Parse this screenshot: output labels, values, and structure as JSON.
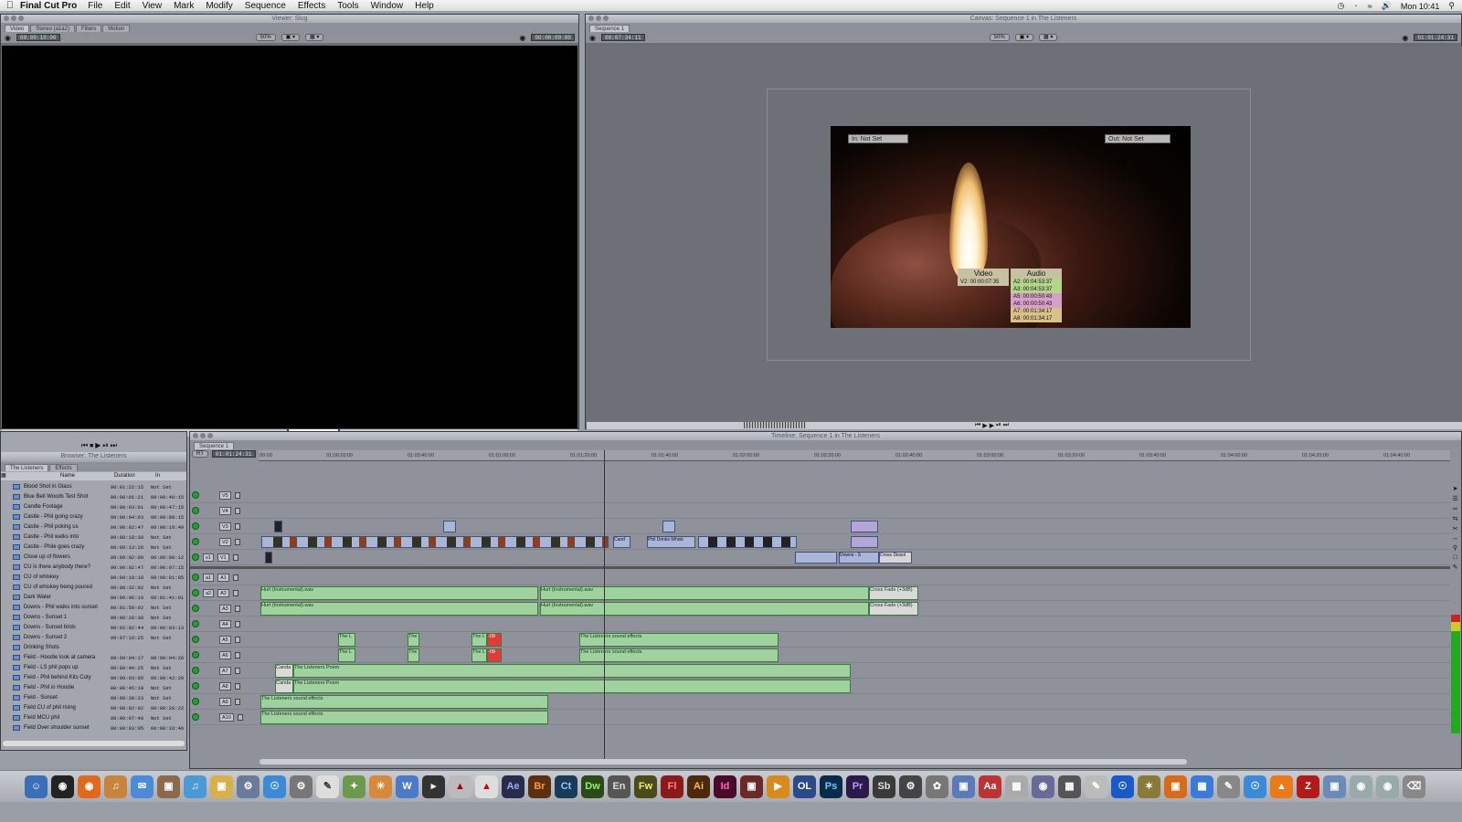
{
  "menubar": {
    "app_name": "Final Cut Pro",
    "menus": [
      "File",
      "Edit",
      "View",
      "Mark",
      "Modify",
      "Sequence",
      "Effects",
      "Tools",
      "Window",
      "Help"
    ],
    "clock": "Mon 10:41"
  },
  "viewer": {
    "title": "Viewer: Slug",
    "tabs": [
      "Video",
      "Stereo (a1a2)",
      "Filters",
      "Motion"
    ],
    "timecode_duration": "00:00:10:00",
    "zoom": "50%",
    "timecode_current": "00:00:00:00"
  },
  "canvas": {
    "title": "Canvas: Sequence 1 in The Listeners",
    "tab": "Sequence 1",
    "timecode_duration": "00:07:34:11",
    "zoom": "50%",
    "timecode_current": "01:01:24:31",
    "in_label": "In: Not Set",
    "out_label": "Out: Not Set",
    "video_box": {
      "header": "Video",
      "line": "V2: 00:00:07:35"
    },
    "audio_box": {
      "header": "Audio",
      "lines": [
        "A2: 00:04:53:37",
        "A3: 00:04:53:37",
        "A5: 00:00:50:43",
        "A6: 00:00:50:43",
        "A7: 00:01:34:17",
        "A8: 00:01:34:17"
      ]
    }
  },
  "browser": {
    "title": "Browser: The Listeners",
    "tabs": [
      "The Listeners",
      "Effects"
    ],
    "columns": {
      "name": "Name",
      "duration": "Duration",
      "in": "In"
    },
    "rows": [
      {
        "name": "Blood Shot in Glass",
        "duration": "00:01:22:15",
        "in": "Not Set"
      },
      {
        "name": "Blue Bell Woods Test Shot",
        "duration": "00:00:01:21",
        "in": "00:00:40:15"
      },
      {
        "name": "Candle Footage",
        "duration": "00:00:03:01",
        "in": "00:00:47:15"
      },
      {
        "name": "Castle - Phil going crazy",
        "duration": "00:00:04:03",
        "in": "00:00:09:15"
      },
      {
        "name": "Castle - Phil poking us",
        "duration": "00:00:02:47",
        "in": "00:00:19:49"
      },
      {
        "name": "Castle - Phil walks into",
        "duration": "00:00:18:30",
        "in": "Not Set"
      },
      {
        "name": "Castle - Phile goes crazy",
        "duration": "00:00:13:26",
        "in": "Not Set"
      },
      {
        "name": "Close up of flowers",
        "duration": "00:00:02:00",
        "in": "00:00:00:12"
      },
      {
        "name": "CU is there anybody there?",
        "duration": "00:00:02:47",
        "in": "00:00:07:15"
      },
      {
        "name": "CU of whiskey",
        "duration": "00:00:10:18",
        "in": "00:00:01:05"
      },
      {
        "name": "CU of whiskey being poured",
        "duration": "00:00:32:02",
        "in": "Not Set"
      },
      {
        "name": "Dark Water",
        "duration": "00:00:06:19",
        "in": "00:01:41:01"
      },
      {
        "name": "Downs - Phil walks into sunset",
        "duration": "00:01:50:02",
        "in": "Not Set"
      },
      {
        "name": "Downs - Sunset 1",
        "duration": "00:00:20:38",
        "in": "Not Set"
      },
      {
        "name": "Downs - Sunset birds",
        "duration": "00:02:02:44",
        "in": "00:00:03:13"
      },
      {
        "name": "Downs - Sunset 2",
        "duration": "00:07:16:25",
        "in": "Not Set"
      },
      {
        "name": "Drinking Shots",
        "duration": "",
        "in": ""
      },
      {
        "name": "Field - Hoodie look at camera",
        "duration": "00:00:04:17",
        "in": "00:00:04:26"
      },
      {
        "name": "Field - LS phil pops up",
        "duration": "00:00:40:25",
        "in": "Not Set"
      },
      {
        "name": "Field - Phil behind Kits Coty",
        "duration": "00:00:03:05",
        "in": "00:00:42:20"
      },
      {
        "name": "Field - Phil in Hoodie",
        "duration": "00:00:45:19",
        "in": "Not Set"
      },
      {
        "name": "Field - Sunset",
        "duration": "00:00:39:23",
        "in": "Not Set"
      },
      {
        "name": "Field CU of phil rising",
        "duration": "00:00:02:02",
        "in": "00:00:20:22"
      },
      {
        "name": "Field MCU phil",
        "duration": "00:00:07:48",
        "in": "Not Set"
      },
      {
        "name": "Field Over shoulder sunset",
        "duration": "00:00:03:05",
        "in": "00:00:16:46"
      }
    ]
  },
  "timeline": {
    "title": "Timeline: Sequence 1 in The Listeners",
    "tab": "Sequence 1",
    "rt": "RT",
    "timecode": "01:01:24:31",
    "ruler": [
      "00:00",
      "01:00:20:00",
      "01:00:40:00",
      "01:01:00:00",
      "01:01:20:00",
      "01:01:40:00",
      "01:02:00:00",
      "01:02:20:00",
      "01:02:40:00",
      "01:03:00:00",
      "01:03:20:00",
      "01:03:40:00",
      "01:04:00:00",
      "01:04:20:00",
      "01:04:40:00"
    ],
    "video_tracks": [
      "V5",
      "V4",
      "V3",
      "V2",
      "V1"
    ],
    "audio_tracks": [
      "A1",
      "A2",
      "A3",
      "A4",
      "A5",
      "A6",
      "A7",
      "A8",
      "A9",
      "A10"
    ],
    "clips": {
      "hurt": "Hurt (Instrumental).wav",
      "cross_fade": "Cross Fade (+3dB)",
      "cross_dissolve": "Cross Dissol",
      "listeners_sfx": "The Listeners sound effects",
      "listeners_poem": "The Listeners Poem",
      "phil_drinks": "Phil Drinks Whisk",
      "downs": "Downs - S",
      "cand": "Cand",
      "canda": "Canda",
      "short_the": "The L",
      "red_mark": "-09"
    }
  },
  "dock": {
    "apps": [
      "Ae",
      "Br",
      "Ct",
      "Dw",
      "En",
      "Fw",
      "Fl",
      "Ai",
      "Id",
      "OL",
      "Ps",
      "Pr",
      "Sb",
      "Aa"
    ]
  }
}
